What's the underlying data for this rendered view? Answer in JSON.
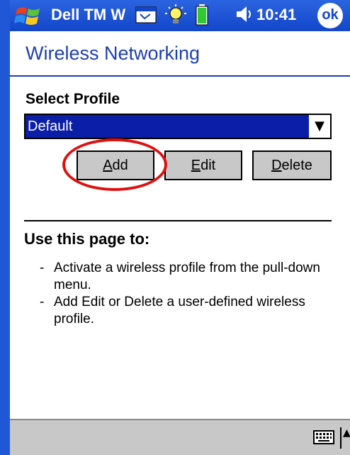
{
  "titlebar": {
    "app_title": "Dell TM W",
    "clock": "10:41",
    "ok_label": "ok"
  },
  "page": {
    "title": "Wireless Networking",
    "select_label": "Select Profile",
    "profile_value": "Default"
  },
  "buttons": {
    "add": "Add",
    "edit": "Edit",
    "delete": "Delete"
  },
  "help": {
    "heading": "Use this page to:",
    "items": [
      "Activate a wireless profile from the pull-down menu.",
      "Add Edit or Delete a user-defined wireless profile."
    ]
  },
  "icons": {
    "start": "windows-flag-icon",
    "taskbar": [
      "taskbar-window-icon",
      "lightbulb-icon",
      "battery-icon",
      "speaker-icon"
    ],
    "keyboard": "keyboard-icon",
    "sip": "sip-arrow-icon"
  },
  "colors": {
    "titlebar": "#1346c9",
    "page_title": "#1f3fb0",
    "selection": "#0a1ea8",
    "highlight_ring": "#e01010",
    "button_face": "#c8c8c8"
  }
}
